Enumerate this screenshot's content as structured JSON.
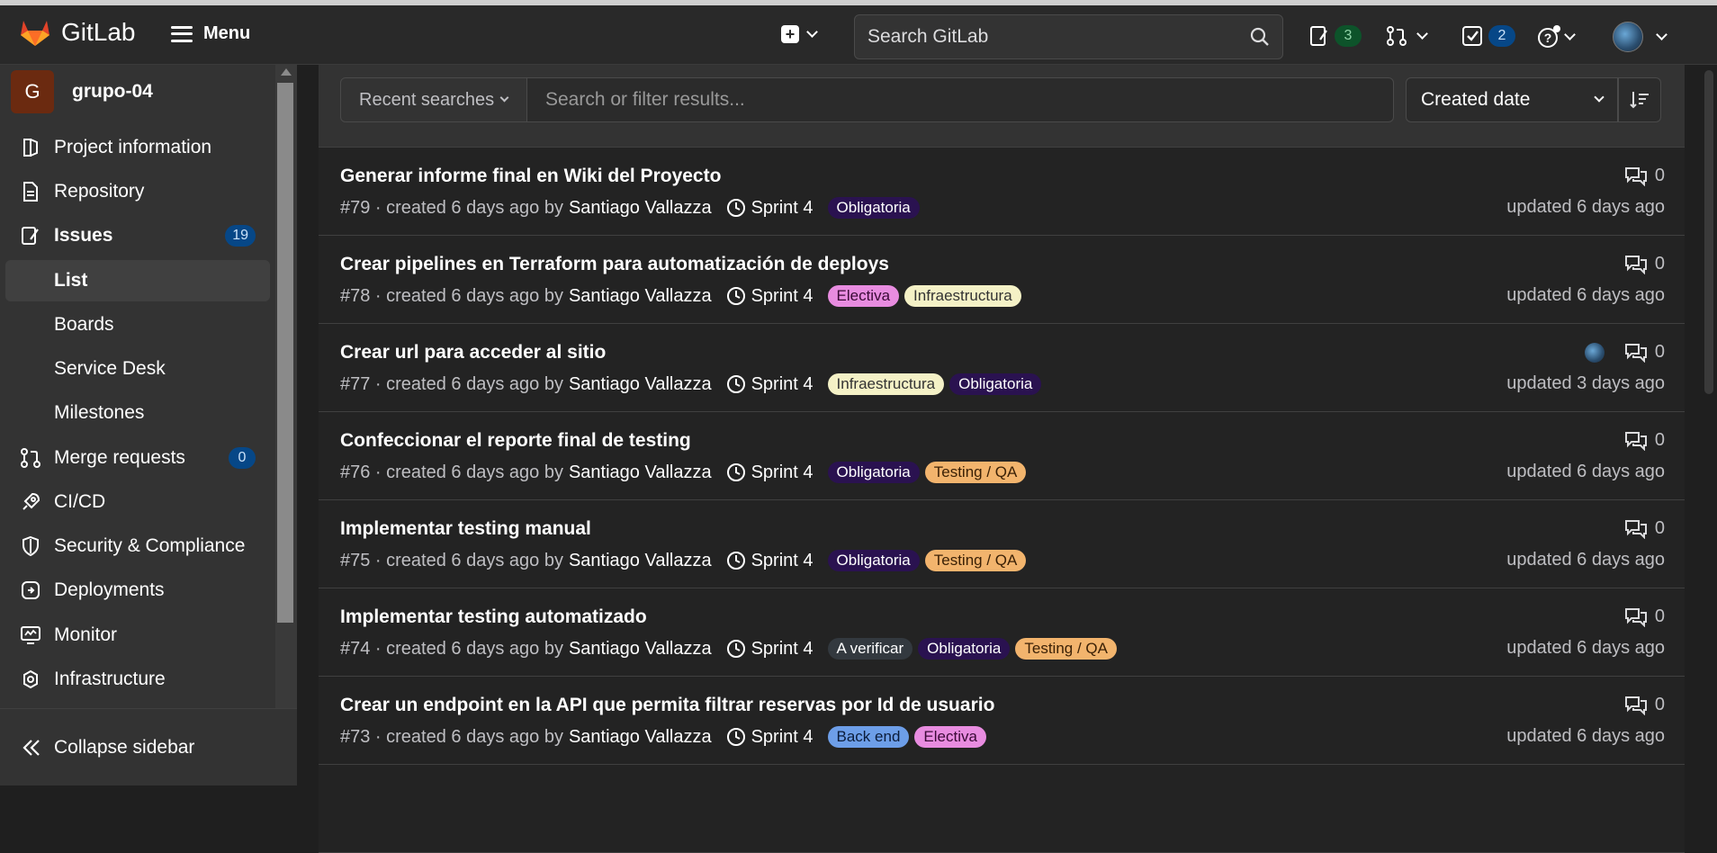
{
  "topbar": {
    "brand": "GitLab",
    "menu_label": "Menu",
    "search_placeholder": "Search GitLab",
    "issues_count": "3",
    "todos_count": "2"
  },
  "sidebar": {
    "project_initial": "G",
    "project_name": "grupo-04",
    "items": [
      {
        "label": "Project information",
        "icon": "info-icon"
      },
      {
        "label": "Repository",
        "icon": "document-icon"
      },
      {
        "label": "Issues",
        "icon": "issues-icon",
        "count": "19"
      },
      {
        "label": "List"
      },
      {
        "label": "Boards"
      },
      {
        "label": "Service Desk"
      },
      {
        "label": "Milestones"
      },
      {
        "label": "Merge requests",
        "icon": "merge-request-icon",
        "count": "0"
      },
      {
        "label": "CI/CD",
        "icon": "rocket-icon"
      },
      {
        "label": "Security & Compliance",
        "icon": "shield-icon"
      },
      {
        "label": "Deployments",
        "icon": "deployments-icon"
      },
      {
        "label": "Monitor",
        "icon": "monitor-icon"
      },
      {
        "label": "Infrastructure",
        "icon": "cloud-gear-icon"
      }
    ],
    "collapse_label": "Collapse sidebar"
  },
  "filters": {
    "recent_label": "Recent searches",
    "search_placeholder": "Search or filter results...",
    "sort_label": "Created date"
  },
  "issues": [
    {
      "title": "Generar informe final en Wiki del Proyecto",
      "meta": "#79 · created 6 days ago by",
      "author": "Santiago Vallazza",
      "milestone": "Sprint 4",
      "labels": [
        "Obligatoria"
      ],
      "comments": "0",
      "updated": "updated 6 days ago"
    },
    {
      "title": "Crear pipelines en Terraform para automatización de deploys",
      "meta": "#78 · created 6 days ago by",
      "author": "Santiago Vallazza",
      "milestone": "Sprint 4",
      "labels": [
        "Electiva",
        "Infraestructura"
      ],
      "comments": "0",
      "updated": "updated 6 days ago"
    },
    {
      "title": "Crear url para acceder al sitio",
      "meta": "#77 · created 6 days ago by",
      "author": "Santiago Vallazza",
      "milestone": "Sprint 4",
      "labels": [
        "Infraestructura",
        "Obligatoria"
      ],
      "comments": "0",
      "updated": "updated 3 days ago"
    },
    {
      "title": "Confeccionar el reporte final de testing",
      "meta": "#76 · created 6 days ago by",
      "author": "Santiago Vallazza",
      "milestone": "Sprint 4",
      "labels": [
        "Obligatoria",
        "Testing / QA"
      ],
      "comments": "0",
      "updated": "updated 6 days ago"
    },
    {
      "title": "Implementar testing manual",
      "meta": "#75 · created 6 days ago by",
      "author": "Santiago Vallazza",
      "milestone": "Sprint 4",
      "labels": [
        "Obligatoria",
        "Testing / QA"
      ],
      "comments": "0",
      "updated": "updated 6 days ago"
    },
    {
      "title": "Implementar testing automatizado",
      "meta": "#74 · created 6 days ago by",
      "author": "Santiago Vallazza",
      "milestone": "Sprint 4",
      "labels": [
        "A verificar",
        "Obligatoria",
        "Testing / QA"
      ],
      "comments": "0",
      "updated": "updated 6 days ago"
    },
    {
      "title": "Crear un endpoint en la API que permita filtrar reservas por Id de usuario",
      "meta": "#73 · created 6 days ago by",
      "author": "Santiago Vallazza",
      "milestone": "Sprint 4",
      "labels": [
        "Back end",
        "Electiva"
      ],
      "comments": "0",
      "updated": "updated 6 days ago"
    }
  ],
  "label_colors": {
    "Obligatoria": {
      "bg": "#2a1250",
      "fg": "#ffffff"
    },
    "Electiva": {
      "bg": "#e88ce0",
      "fg": "#3a0a36"
    },
    "Infraestructura": {
      "bg": "#f4f1c6",
      "fg": "#333333"
    },
    "Testing / QA": {
      "bg": "#f2b46d",
      "fg": "#3b2106"
    },
    "A verificar": {
      "bg": "#33393f",
      "fg": "#ffffff"
    },
    "Back end": {
      "bg": "#6d9ee8",
      "fg": "#0b1c3a"
    }
  }
}
